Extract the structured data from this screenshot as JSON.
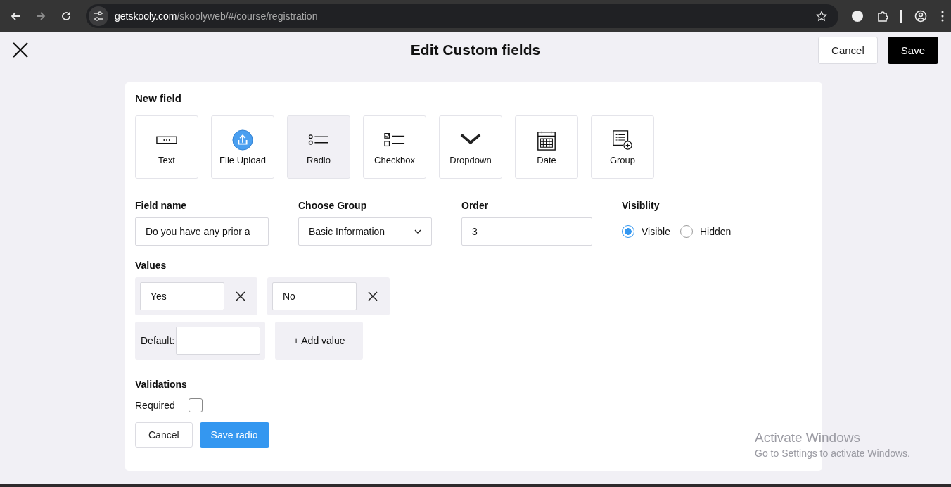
{
  "browser": {
    "url_host": "getskooly.com",
    "url_path": "/skoolyweb/#/course/registration"
  },
  "header": {
    "title": "Edit Custom fields",
    "buttons": [
      {
        "label": "Cancel",
        "kind": "secondary"
      },
      {
        "label": "Save",
        "kind": "primary"
      }
    ]
  },
  "new_field": {
    "title": "New field",
    "types": [
      {
        "label": "Text",
        "kind": "text",
        "selected": false
      },
      {
        "label": "File Upload",
        "kind": "upload",
        "selected": false
      },
      {
        "label": "Radio",
        "kind": "radio",
        "selected": true
      },
      {
        "label": "Checkbox",
        "kind": "checkbox",
        "selected": false
      },
      {
        "label": "Dropdown",
        "kind": "dropdown",
        "selected": false
      },
      {
        "label": "Date",
        "kind": "date",
        "selected": false
      },
      {
        "label": "Group",
        "kind": "group",
        "selected": false
      }
    ]
  },
  "form": {
    "field_name": {
      "label": "Field name",
      "value": "Do you have any prior a"
    },
    "choose_group": {
      "label": "Choose Group",
      "value": "Basic Information"
    },
    "order": {
      "label": "Order",
      "value": "3"
    },
    "visibility": {
      "label": "Visiblity",
      "options": [
        {
          "label": "Visible",
          "selected": true
        },
        {
          "label": "Hidden",
          "selected": false
        }
      ]
    }
  },
  "values": {
    "title": "Values",
    "items": [
      {
        "value": "Yes"
      },
      {
        "value": "No"
      }
    ],
    "default_label": "Default:",
    "add_button": "+ Add value"
  },
  "validations": {
    "title": "Validations",
    "required": {
      "label": "Required",
      "checked": false
    }
  },
  "footer": {
    "buttons": [
      {
        "label": "Cancel",
        "kind": "secondary"
      },
      {
        "label": "Save radio",
        "kind": "primary"
      }
    ]
  },
  "os_notice": {
    "title": "Activate Windows",
    "subtitle": "Go to Settings to activate Windows."
  }
}
